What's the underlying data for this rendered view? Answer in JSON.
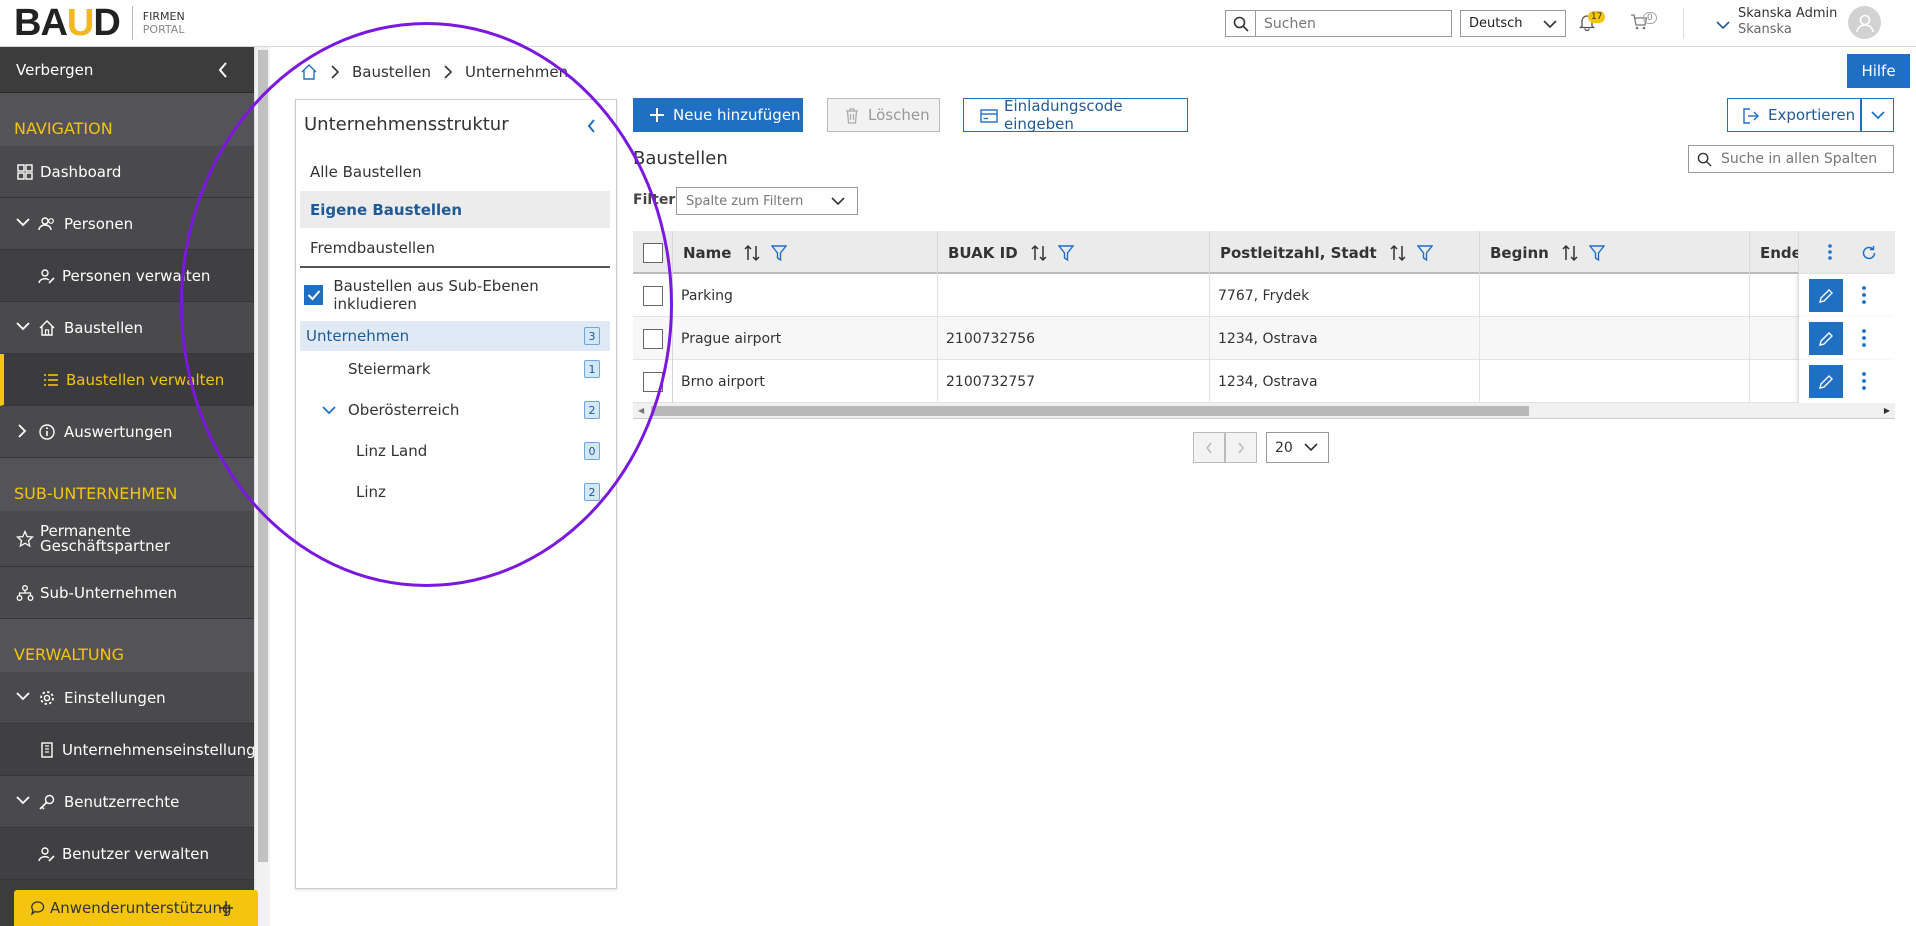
{
  "header": {
    "logo_text": "BAUD",
    "logo_sub1": "FIRMEN",
    "logo_sub2": "PORTAL",
    "search_placeholder": "Suchen",
    "language": "Deutsch",
    "notifications_count": "17",
    "cart_count": "0",
    "user_name": "Skanska Admin",
    "user_company": "Skanska"
  },
  "sidebar": {
    "hide_label": "Verbergen",
    "sections": {
      "navigation": "NAVIGATION",
      "sub": "SUB-UNTERNEHMEN",
      "admin": "VERWALTUNG"
    },
    "items": {
      "dashboard": "Dashboard",
      "personen": "Personen",
      "personen_verwalten": "Personen verwalten",
      "baustellen": "Baustellen",
      "baustellen_verwalten": "Baustellen verwalten",
      "auswertungen": "Auswertungen",
      "permanente": "Permanente Geschäftspartner",
      "sub_unternehmen": "Sub-Unternehmen",
      "einstellungen": "Einstellungen",
      "unternehmenseinstellungen": "Unternehmenseinstellungen",
      "benutzerrechte": "Benutzerrechte",
      "benutzer_verwalten": "Benutzer verwalten"
    },
    "support": "Anwenderunterstützung"
  },
  "breadcrumb": {
    "level1": "Baustellen",
    "level2": "Unternehmen"
  },
  "help_label": "Hilfe",
  "tree_panel": {
    "title": "Unternehmensstruktur",
    "filters": [
      "Alle Baustellen",
      "Eigene Baustellen",
      "Fremdbaustellen"
    ],
    "include_sub_label": "Baustellen aus Sub-Ebenen inkludieren",
    "nodes": [
      {
        "label": "Unternehmen",
        "count": "3"
      },
      {
        "label": "Steiermark",
        "count": "1"
      },
      {
        "label": "Oberösterreich",
        "count": "2"
      },
      {
        "label": "Linz Land",
        "count": "0"
      },
      {
        "label": "Linz",
        "count": "2"
      }
    ]
  },
  "toolbar": {
    "add": "Neue hinzufügen",
    "delete": "Löschen",
    "invite": "Einladungscode eingeben",
    "export": "Exportieren"
  },
  "table": {
    "title": "Baustellen",
    "search_placeholder": "Suche in allen Spalten",
    "filter_label": "Filter",
    "filter_placeholder": "Spalte zum Filtern",
    "columns": [
      "Name",
      "BUAK ID",
      "Postleitzahl, Stadt",
      "Beginn",
      "Ende"
    ],
    "rows": [
      {
        "name": "Parking",
        "buak": "",
        "city": "7767, Frydek",
        "begin": ""
      },
      {
        "name": "Prague airport",
        "buak": "2100732756",
        "city": "1234, Ostrava",
        "begin": ""
      },
      {
        "name": "Brno airport",
        "buak": "2100732757",
        "city": "1234, Ostrava",
        "begin": ""
      }
    ]
  },
  "pager": {
    "page_size": "20"
  },
  "colors": {
    "accent": "#1f6fc5",
    "brand_yellow": "#f4c40f",
    "sidebar_bg": "#4a494c",
    "annotation": "#7b18e0"
  }
}
